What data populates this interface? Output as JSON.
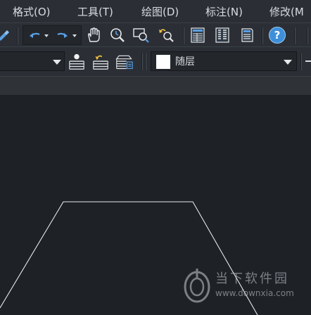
{
  "menu": {
    "items": [
      {
        "label": "格式(O)"
      },
      {
        "label": "工具(T)"
      },
      {
        "label": "绘图(D)"
      },
      {
        "label": "标注(N)"
      },
      {
        "label": "修改(M"
      }
    ]
  },
  "toolbar": {
    "icons": [
      "pin-icon",
      "undo-icon",
      "redo-icon",
      "pan-hand-icon",
      "zoom-realtime-icon",
      "zoom-window-icon",
      "zoom-previous-icon",
      "properties-palette-icon",
      "design-center-icon",
      "tool-palette-icon",
      "help-icon"
    ],
    "help_label": "?"
  },
  "layer_bar": {
    "layer_icons": [
      "layer-states-icon",
      "layer-previous-icon",
      "layer-manager-icon"
    ],
    "color_combo_value": "随层",
    "color_swatch": "#ffffff"
  },
  "canvas": {
    "background": "#1e2227",
    "line_color": "#e8e8e8"
  },
  "watermark": {
    "brand": "当下软件园",
    "url": "www.downxia.com"
  }
}
